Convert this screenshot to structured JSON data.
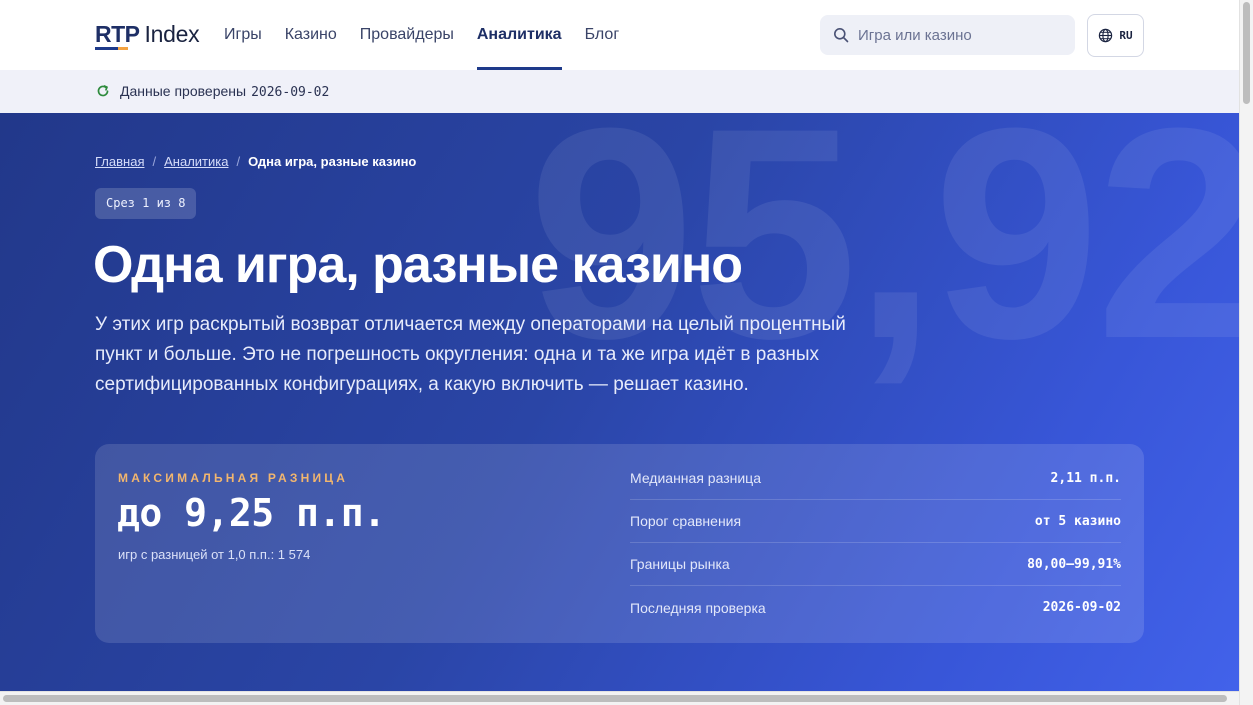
{
  "header": {
    "logo_primary": "RTP",
    "logo_secondary": "Index",
    "nav": [
      {
        "label": "Игры",
        "active": false
      },
      {
        "label": "Казино",
        "active": false
      },
      {
        "label": "Провайдеры",
        "active": false
      },
      {
        "label": "Аналитика",
        "active": true
      },
      {
        "label": "Блог",
        "active": false
      }
    ],
    "search_placeholder": "Игра или казино",
    "search_icon": "search-icon",
    "language": "RU",
    "language_icon": "globe-icon"
  },
  "verified": {
    "label": "Данные проверены",
    "date": "2026-09-02",
    "icon": "refresh-icon"
  },
  "hero": {
    "watermark": "95,92",
    "breadcrumb": {
      "home": "Главная",
      "section": "Аналитика",
      "current": "Одна игра, разные казино",
      "separator": "/"
    },
    "slice_badge": "Срез 1 из 8",
    "title": "Одна игра, разные казино",
    "description": "У этих игр раскрытый возврат отличается между операторами на целый процентный пункт и больше. Это не погрешность округления: одна и та же игра идёт в разных сертифицированных конфигурациях, а какую включить — решает казино."
  },
  "card": {
    "kicker": "МАКСИМАЛЬНАЯ РАЗНИЦА",
    "headline": "до 9,25 п.п.",
    "subline": "игр с разницей от 1,0 п.п.: 1 574",
    "stats": [
      {
        "label": "Медианная разница",
        "value": "2,11 п.п."
      },
      {
        "label": "Порог сравнения",
        "value": "от 5 казино"
      },
      {
        "label": "Границы рынка",
        "value": "80,00–99,91%"
      },
      {
        "label": "Последняя проверка",
        "value": "2026-09-02"
      }
    ]
  },
  "colors": {
    "brand_navy": "#1e2f66",
    "accent_orange": "#f4a340",
    "kicker_orange": "#f2b66e",
    "hero_start": "#22388a",
    "hero_end": "#4262ea",
    "verify_green": "#2e8b3d"
  }
}
